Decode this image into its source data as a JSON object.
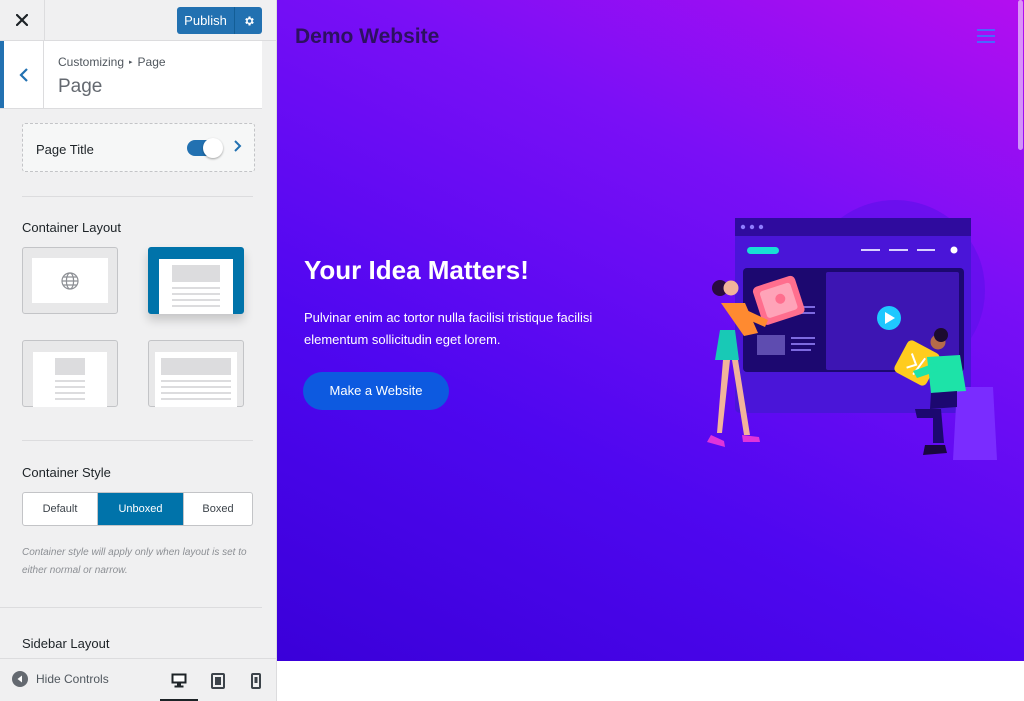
{
  "topbar": {
    "publish_label": "Publish"
  },
  "section": {
    "breadcrumb_root": "Customizing",
    "breadcrumb_current": "Page",
    "title": "Page"
  },
  "page_title_control": {
    "label": "Page Title",
    "enabled": true
  },
  "container_layout": {
    "label": "Container Layout",
    "options": [
      "Default",
      "Normal",
      "Narrow",
      "Full Width"
    ],
    "selected": "Normal"
  },
  "container_style": {
    "label": "Container Style",
    "options": [
      {
        "label": "Default",
        "active": false
      },
      {
        "label": "Unboxed",
        "active": true
      },
      {
        "label": "Boxed",
        "active": false
      }
    ],
    "hint": "Container style will apply only when layout is set to either normal or narrow."
  },
  "sidebar_layout": {
    "label": "Sidebar Layout"
  },
  "footer": {
    "hide_controls_label": "Hide Controls",
    "devices": [
      "desktop",
      "tablet",
      "mobile"
    ],
    "active_device": "desktop"
  },
  "preview": {
    "site_title": "Demo Website",
    "hero_title": "Your Idea Matters!",
    "hero_text": "Pulvinar enim ac tortor nulla facilisi tristique facilisi elementum sollicitudin eget lorem.",
    "cta_label": "Make a Website"
  },
  "colors": {
    "accent": "#2271b1",
    "selected": "#0073aa",
    "hero_start": "#b40ef0",
    "hero_end": "#3a00d9",
    "cta": "#0d5ae0"
  }
}
